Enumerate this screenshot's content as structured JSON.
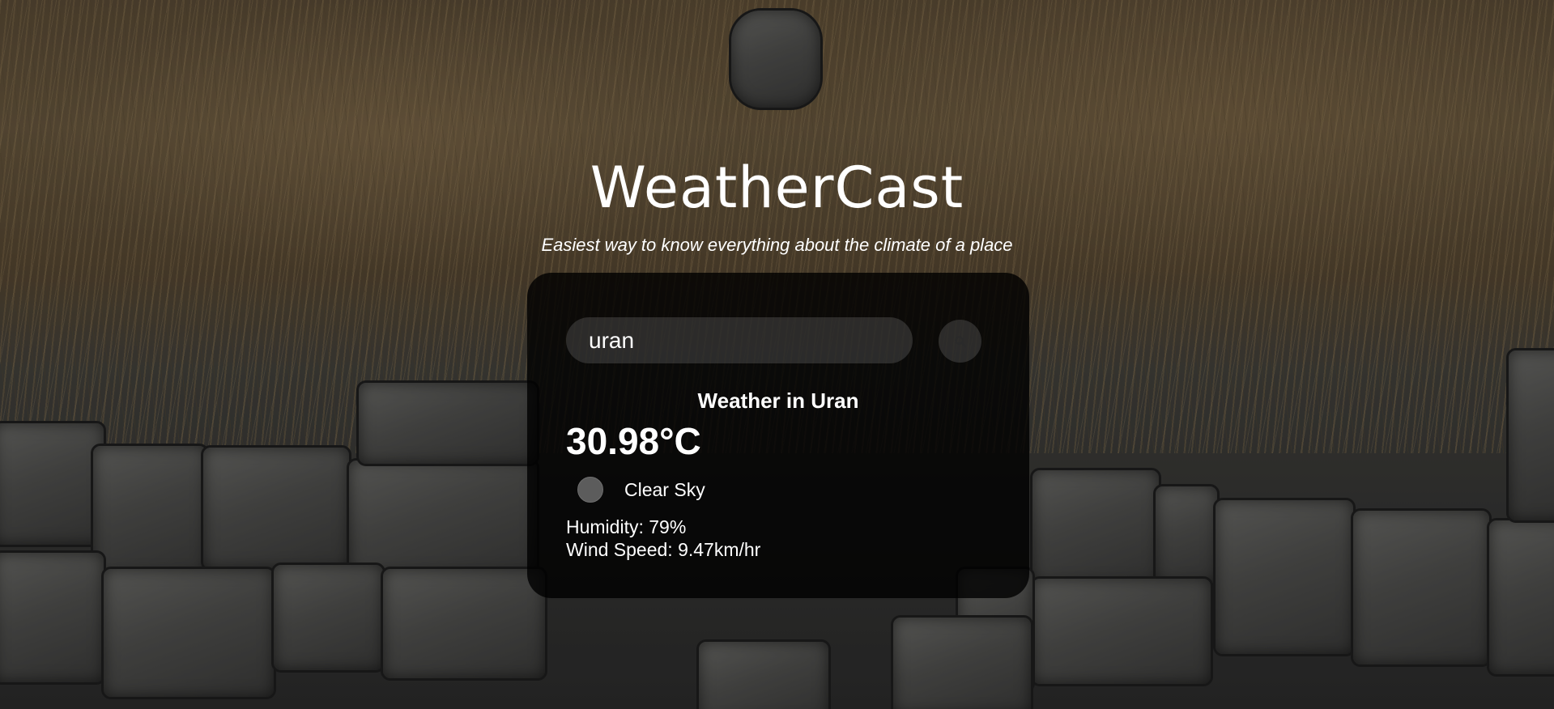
{
  "app": {
    "title": "WeatherCast",
    "subtitle": "Easiest way to know everything about the climate of a place"
  },
  "search": {
    "value": "uran",
    "placeholder": "",
    "button_icon": "search-icon"
  },
  "weather": {
    "heading": "Weather in Uran",
    "temperature": "30.98°C",
    "icon": "weather-condition-icon",
    "description": "Clear Sky",
    "humidity": "Humidity: 79%",
    "wind": "Wind Speed: 9.47km/hr"
  },
  "colors": {
    "card_background": "#000000",
    "input_background": "#7c7c7c",
    "text": "#ffffff"
  }
}
